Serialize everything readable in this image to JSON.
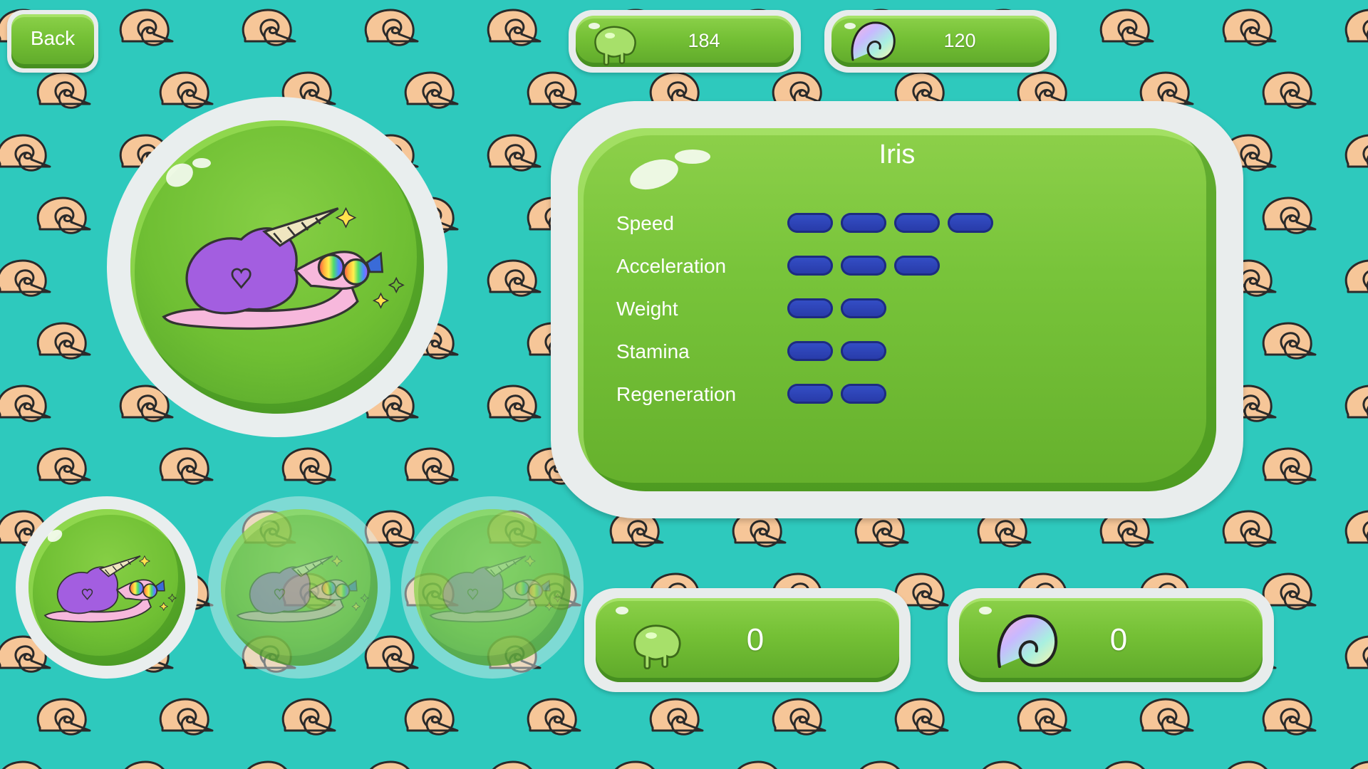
{
  "back_button": {
    "label": "Back"
  },
  "currency": {
    "slime": {
      "icon": "slime-icon",
      "value": "184"
    },
    "shells": {
      "icon": "rainbow-shell-icon",
      "value": "120"
    }
  },
  "selected_snail": {
    "name": "Iris",
    "image": "unicorn-snail-image",
    "stats": [
      {
        "label": "Speed",
        "level": 4
      },
      {
        "label": "Acceleration",
        "level": 3
      },
      {
        "label": "Weight",
        "level": 2
      },
      {
        "label": "Stamina",
        "level": 2
      },
      {
        "label": "Regeneration",
        "level": 2
      }
    ]
  },
  "snail_slots": [
    {
      "image": "unicorn-snail-image",
      "state": "selected"
    },
    {
      "image": "unicorn-snail-image",
      "state": "locked"
    },
    {
      "image": "unicorn-snail-image",
      "state": "locked"
    }
  ],
  "cost": {
    "slime": {
      "icon": "slime-icon",
      "value": "0"
    },
    "shells": {
      "icon": "rainbow-shell-icon",
      "value": "0"
    }
  },
  "colors": {
    "background": "#2ec9bd",
    "panel_green": "#74c035",
    "stat_bar": "#2c40b0",
    "shell_pattern": "#f6c698"
  }
}
